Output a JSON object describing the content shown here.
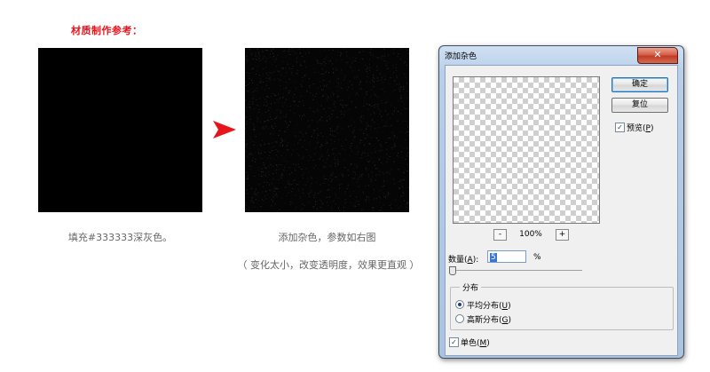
{
  "tutorial": {
    "heading": "材质制作参考：",
    "caption_left": "填充#333333深灰色。",
    "caption_right": "添加杂色，参数如右图",
    "caption_note": "（ 变化太小，改变透明度，效果更直观 ）"
  },
  "colors": {
    "accent_red": "#e8141b",
    "fill_dark": "#000000"
  },
  "dialog": {
    "title": "添加杂色",
    "close_glyph": "✕",
    "buttons": {
      "ok": "确定",
      "reset": "复位"
    },
    "preview": {
      "checked": true,
      "label": "预览(",
      "key": "P",
      "suffix": ")"
    },
    "zoom": {
      "minus": "-",
      "plus": "+",
      "level": "100%"
    },
    "amount": {
      "label": "数量(",
      "key": "A",
      "suffix": "):",
      "value": "5",
      "unit": "%"
    },
    "distribution": {
      "title": "分布",
      "options": [
        {
          "label": "平均分布(",
          "key": "U",
          "suffix": ")",
          "selected": true
        },
        {
          "label": "高斯分布(",
          "key": "G",
          "suffix": ")",
          "selected": false
        }
      ]
    },
    "monochromatic": {
      "checked": true,
      "label": "单色(",
      "key": "M",
      "suffix": ")"
    }
  }
}
